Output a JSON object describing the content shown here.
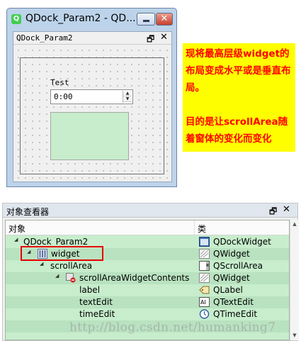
{
  "window": {
    "title": "QDock_Param2 - QD...",
    "logo_letter": "Q",
    "close_glyph": "✕",
    "dock": {
      "title": "QDock_Param2",
      "float_glyph": "🗗",
      "close_glyph": "✕"
    },
    "form": {
      "label_text": "Test",
      "time_value": "0:00",
      "spin_up": "▲",
      "spin_down": "▼",
      "textedit_color": "#c7edcc"
    }
  },
  "note": {
    "line1": "现将最高层级widget的布局变成水平或是垂直布局。",
    "line2": "目的是让scrollArea随着窗体的变化而变化",
    "bg_color": "#fefe00",
    "text_color": "#ff0000"
  },
  "inspector": {
    "title": "对象查看器",
    "float_glyph": "🗗",
    "close_glyph": "✕",
    "columns": [
      "对象",
      "类"
    ],
    "rows": [
      {
        "name": "QDock_Param2",
        "cls": "QDockWidget",
        "cls_icon": "dock-widget-icon",
        "expander": "◢"
      },
      {
        "name": "widget",
        "cls": "QWidget",
        "cls_icon": "widget-icon",
        "expander": "◢"
      },
      {
        "name": "scrollArea",
        "cls": "QScrollArea",
        "cls_icon": "scroll-area-icon",
        "expander": "◢"
      },
      {
        "name": "scrollAreaWidgetContents",
        "cls": "QWidget",
        "cls_icon": "widget-icon",
        "expander": "◢"
      },
      {
        "name": "label",
        "cls": "QLabel",
        "cls_icon": "label-icon",
        "expander": ""
      },
      {
        "name": "textEdit",
        "cls": "QTextEdit",
        "cls_icon": "text-edit-icon",
        "expander": ""
      },
      {
        "name": "timeEdit",
        "cls": "QTimeEdit",
        "cls_icon": "time-edit-icon",
        "expander": ""
      }
    ],
    "scroll_up": "▲",
    "scroll_down": "▼",
    "highlight_color": "#e60000"
  },
  "watermark": "http://blog.csdn.net/humanking7"
}
